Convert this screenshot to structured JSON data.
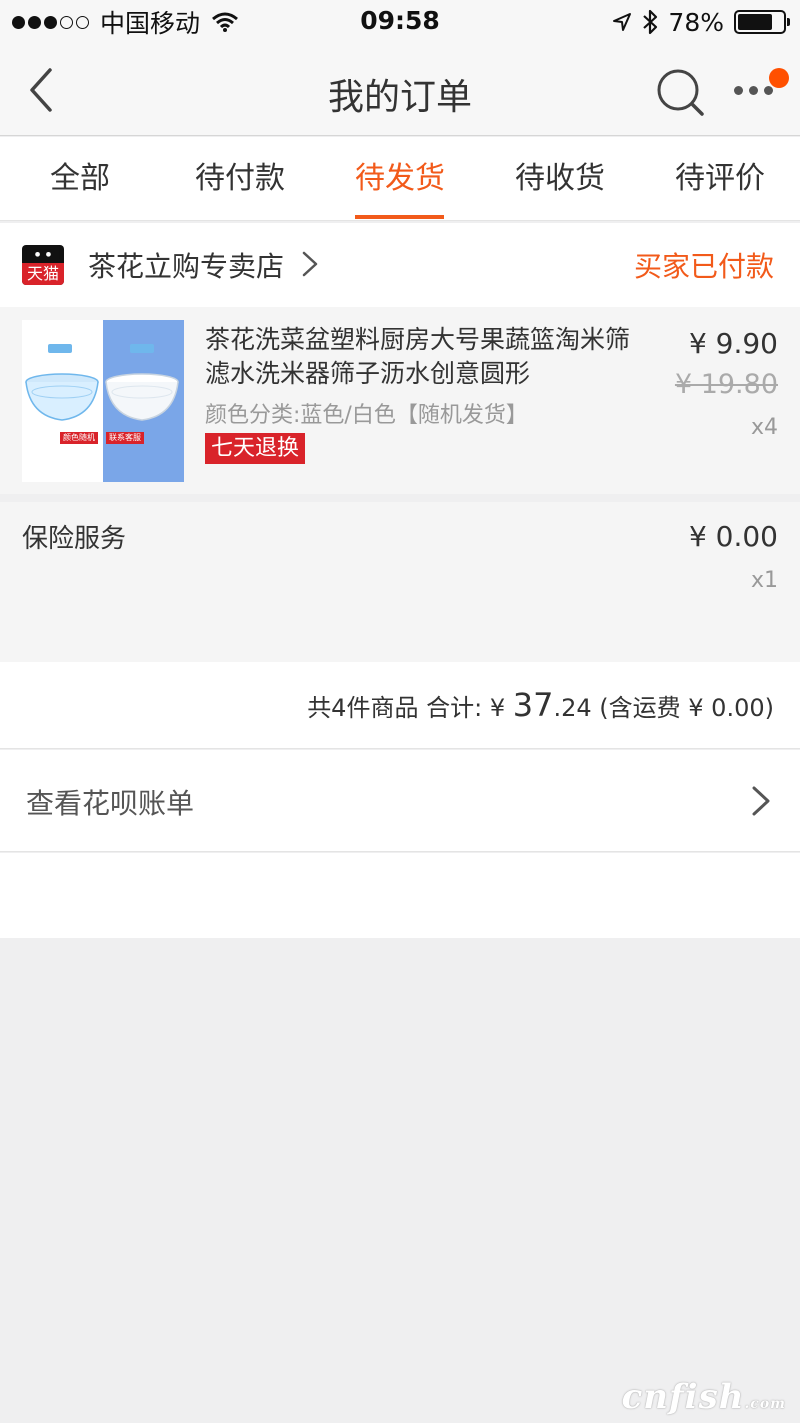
{
  "status_bar": {
    "carrier": "中国移动",
    "time": "09:58",
    "battery": "78%",
    "battery_level": 0.78
  },
  "nav": {
    "title": "我的订单"
  },
  "tabs": [
    {
      "label": "全部"
    },
    {
      "label": "待付款"
    },
    {
      "label": "待发货"
    },
    {
      "label": "待收货"
    },
    {
      "label": "待评价"
    }
  ],
  "active_tab_index": 2,
  "shop": {
    "logo_text": "天猫",
    "name": "茶花立购专卖店",
    "status": "买家已付款"
  },
  "product": {
    "title": "茶花洗菜盆塑料厨房大号果蔬篮淘米筛滤水洗米器筛子沥水创意圆形",
    "spec": "颜色分类:蓝色/白色【随机发货】",
    "badge": "七天退换",
    "price": "¥ 9.90",
    "original_price": "¥ 19.80",
    "quantity": "x4",
    "thumb_tag_1": "颜色随机",
    "thumb_tag_2": "联系客服"
  },
  "insurance": {
    "label": "保险服务",
    "price": "¥ 0.00",
    "quantity": "x1"
  },
  "total": {
    "count_text": "共4件商品",
    "sum_label": "合计:",
    "currency": "¥",
    "amount_int": "37",
    "amount_dec": ".24",
    "shipping": "(含运费 ¥ 0.00)"
  },
  "bill": {
    "label": "查看花呗账单"
  },
  "watermark": {
    "text": "cnfish",
    "suffix": ".com"
  },
  "colors": {
    "accent": "#f25a1a",
    "badge_red": "#d9232a",
    "notification": "#ff5000"
  }
}
